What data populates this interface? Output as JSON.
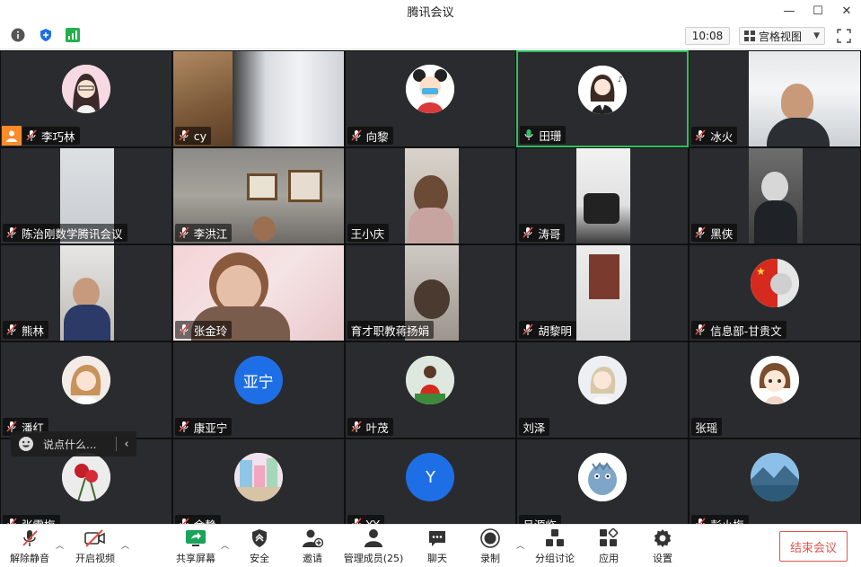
{
  "window": {
    "title": "腾讯会议"
  },
  "topbar": {
    "time": "10:08",
    "view_label": "宫格视图"
  },
  "participants": [
    {
      "name": "李巧林"
    },
    {
      "name": "cy"
    },
    {
      "name": "向黎"
    },
    {
      "name": "田珊"
    },
    {
      "name": "冰火"
    },
    {
      "name": "陈治刚数学腾讯会议"
    },
    {
      "name": "李洪江"
    },
    {
      "name": "王小庆"
    },
    {
      "name": "涛哥"
    },
    {
      "name": "黑侠"
    },
    {
      "name": "熊林"
    },
    {
      "name": "张金玲"
    },
    {
      "name": "育才职教蒋扬娟"
    },
    {
      "name": "胡黎明"
    },
    {
      "name": "信息部-甘贵文"
    },
    {
      "name": "潘红"
    },
    {
      "name": "康亚宁",
      "avatar_text": "亚宁"
    },
    {
      "name": "叶茂"
    },
    {
      "name": "刘泽"
    },
    {
      "name": "张瑶"
    },
    {
      "name": "张雪梅"
    },
    {
      "name": "余静"
    },
    {
      "name": "YY",
      "avatar_text": "Y"
    },
    {
      "name": "吕源临"
    },
    {
      "name": "彭小梅"
    }
  ],
  "chat": {
    "placeholder": "说点什么..."
  },
  "toolbar": {
    "unmute": "解除静音",
    "start_video": "开启视频",
    "share_screen": "共享屏幕",
    "security": "安全",
    "invite": "邀请",
    "manage_members": "管理成员(25)",
    "chat": "聊天",
    "record": "录制",
    "breakout": "分组讨论",
    "apps": "应用",
    "settings": "设置",
    "end_meeting": "结束会议"
  },
  "colors": {
    "active_speaker": "#2fbf5f",
    "end_red": "#e0564f",
    "host_badge": "#ff8a2a",
    "mute_red": "#e34d45"
  }
}
